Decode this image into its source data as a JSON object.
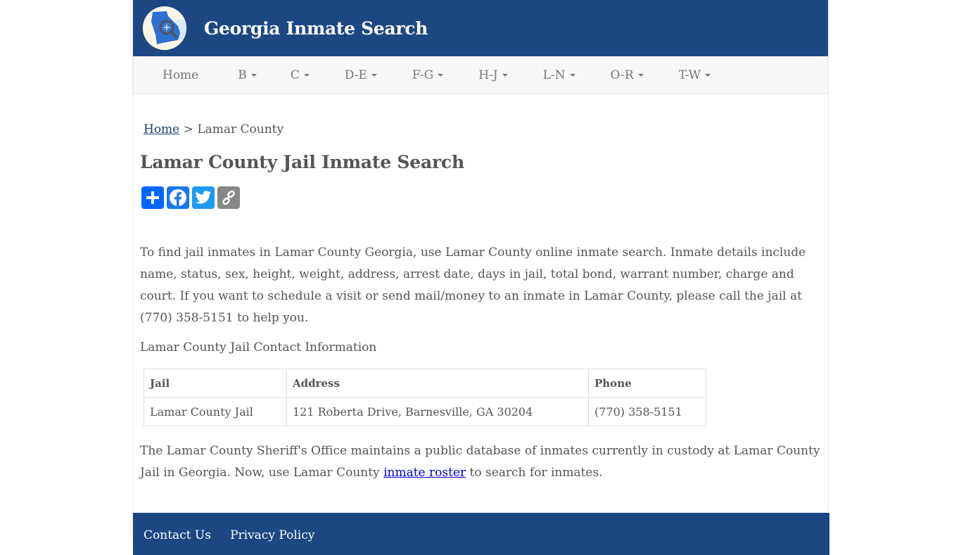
{
  "header": {
    "site_title": "Georgia Inmate Search",
    "logo_icon": "georgia-map-magnifier-icon",
    "brand_color": "#1c4783"
  },
  "nav": {
    "items": [
      {
        "label": "Home",
        "dropdown": false
      },
      {
        "label": "B",
        "dropdown": true
      },
      {
        "label": "C",
        "dropdown": true
      },
      {
        "label": "D-E",
        "dropdown": true
      },
      {
        "label": "F-G",
        "dropdown": true
      },
      {
        "label": "H-J",
        "dropdown": true
      },
      {
        "label": "L-N",
        "dropdown": true
      },
      {
        "label": "O-R",
        "dropdown": true
      },
      {
        "label": "T-W",
        "dropdown": true
      }
    ]
  },
  "breadcrumb": {
    "home": "Home",
    "separator": " > ",
    "current": "Lamar County"
  },
  "main": {
    "title": "Lamar County Jail Inmate Search",
    "share": {
      "buttons": [
        {
          "name": "share",
          "icon": "plus-icon",
          "color": "#0166ff"
        },
        {
          "name": "facebook",
          "icon": "facebook-icon",
          "color": "#1877f2"
        },
        {
          "name": "twitter",
          "icon": "twitter-icon",
          "color": "#1d9bf0"
        },
        {
          "name": "copy-link",
          "icon": "link-icon",
          "color": "#888888"
        }
      ]
    },
    "intro": "To find jail inmates in Lamar County Georgia, use Lamar County online inmate search. Inmate details include name, status, sex, height, weight, address, arrest date, days in jail, total bond, warrant number, charge and court. If you want to schedule a visit or send mail/money to an inmate in Lamar County, please call the jail at (770) 358-5151 to help you.",
    "contact_heading": "Lamar County Jail Contact Information",
    "table": {
      "headers": [
        "Jail",
        "Address",
        "Phone"
      ],
      "rows": [
        [
          "Lamar County Jail",
          "121 Roberta Drive, Barnesville, GA 30204",
          "(770) 358-5151"
        ]
      ]
    },
    "outro_before": "The Lamar County Sheriff's Office maintains a public database of inmates currently in custody at Lamar County Jail in Georgia. Now, use Lamar County ",
    "outro_link": "inmate roster",
    "outro_after": " to search for inmates."
  },
  "footer": {
    "links": [
      "Contact Us",
      "Privacy Policy"
    ]
  }
}
